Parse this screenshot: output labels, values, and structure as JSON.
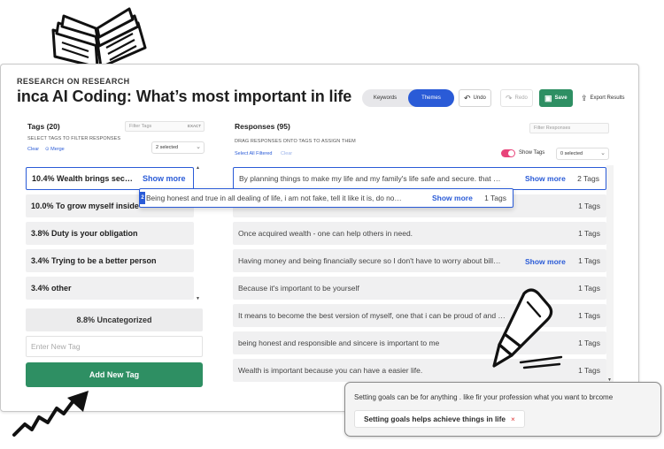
{
  "app": {
    "eyebrow": "RESEARCH ON RESEARCH",
    "title": "inca AI Coding: What’s most important in life"
  },
  "toolbar": {
    "keywords_label": "Keywords",
    "themes_label": "Themes",
    "undo_label": "Undo",
    "redo_label": "Redo",
    "save_label": "Save",
    "export_label": "Export Results"
  },
  "tags_panel": {
    "heading": "Tags (20)",
    "filter_placeholder": "Filter Tags",
    "exact_label": "EXACT",
    "hint": "SELECT TAGS TO FILTER RESPONSES",
    "clear_label": "Clear",
    "merge_label": "Merge",
    "selected_label": "2 selected",
    "tags": [
      {
        "label": "10.4% Wealth brings sec…",
        "active": true
      },
      {
        "label": "10.0% To grow myself inside"
      },
      {
        "label": "3.8% Duty is your obligation"
      },
      {
        "label": "3.4% Trying to be a better person"
      },
      {
        "label": "3.4% other"
      }
    ],
    "show_more_label": "Show more",
    "uncategorized_label": "8.8% Uncategorized",
    "new_tag_placeholder": "Enter New Tag",
    "add_tag_label": "Add New Tag"
  },
  "responses_panel": {
    "heading": "Responses (95)",
    "filter_placeholder": "Filter Responses",
    "hint": "DRAG RESPONSES ONTO TAGS TO ASSIGN THEM",
    "select_all_label": "Select All Filtered",
    "clear_label": "Clear",
    "show_tags_label": "Show Tags",
    "selected_label": "0 selected",
    "show_more_label": "Show more",
    "rows": [
      {
        "text": "By planning things to make my life and my family's life safe and secure. that …",
        "tags": "2 Tags",
        "more": true
      },
      {
        "text": "",
        "tags": "1 Tags"
      },
      {
        "text": "Once acquired wealth - one can help others in need.",
        "tags": "1 Tags"
      },
      {
        "text": "Having money and being financially secure so I don't have to worry about bill…",
        "tags": "1 Tags",
        "more": true
      },
      {
        "text": "Because it's important to be yourself",
        "tags": "1 Tags"
      },
      {
        "text": "It means to become the best version of myself, one that i can be proud of and …",
        "tags": "1 Tags"
      },
      {
        "text": "being honest and responsible and sincere is important to me",
        "tags": "1 Tags"
      },
      {
        "text": "Wealth is important because you can have a easier life.",
        "tags": "1 Tags"
      }
    ]
  },
  "drag_card": {
    "badge": "2",
    "text": "Being honest and true in all dealing of life, i am not fake, tell it like it is, do no…",
    "more_label": "Show more",
    "tags": "1 Tags"
  },
  "callout": {
    "text": "Setting goals can be for anything . like fir your profession what you want to brcome",
    "chip_label": "Setting goals helps achieve things in life",
    "chip_remove": "×"
  },
  "colors": {
    "accent": "#2a5bd7",
    "save_green": "#2e8f63",
    "toggle_pink": "#e8447a"
  }
}
